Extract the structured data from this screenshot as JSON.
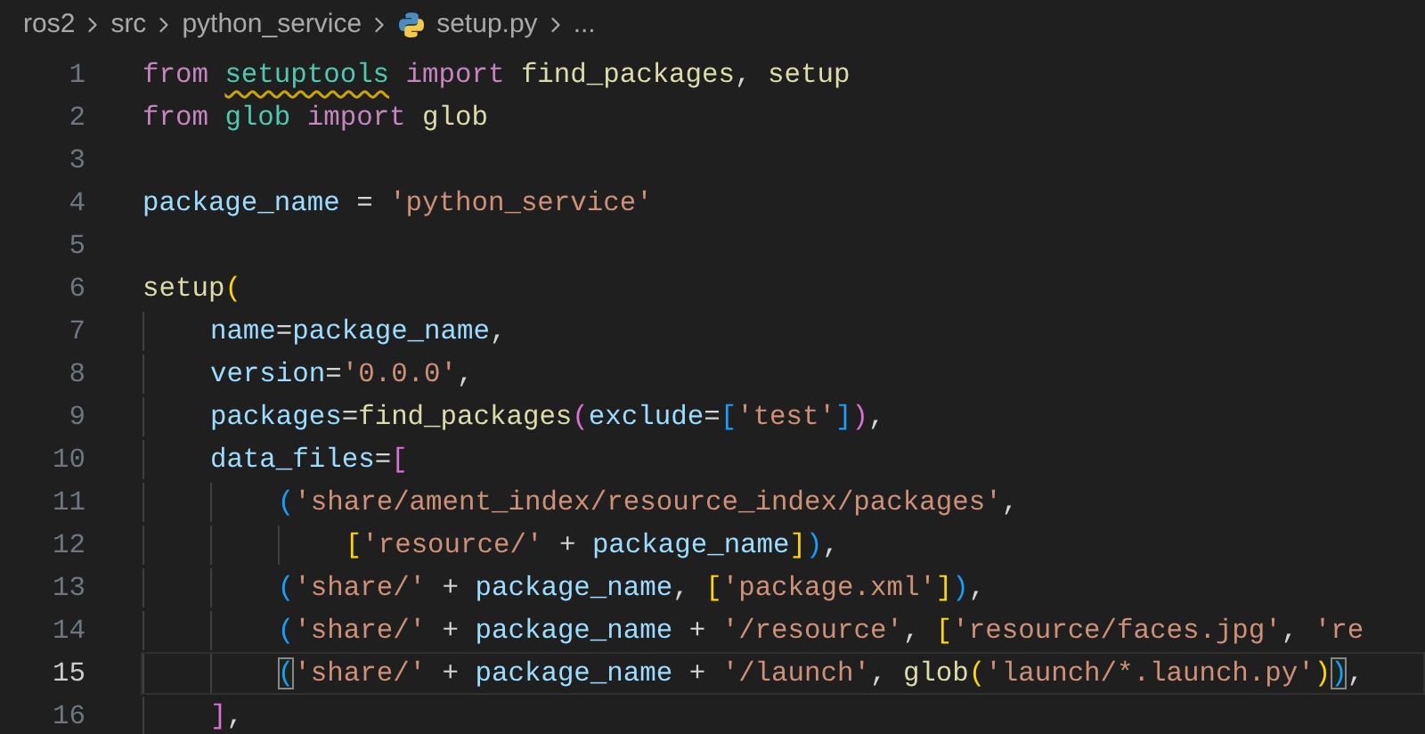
{
  "breadcrumb": [
    {
      "label": "ros2",
      "kind": "folder"
    },
    {
      "label": "src",
      "kind": "folder"
    },
    {
      "label": "python_service",
      "kind": "folder"
    },
    {
      "label": "setup.py",
      "kind": "python-file"
    },
    {
      "label": "...",
      "kind": "more"
    }
  ],
  "editor": {
    "lines": [
      {
        "number": "1",
        "current": false,
        "tokens": [
          {
            "text": "from ",
            "kind": "keyword"
          },
          {
            "text": "setuptools",
            "kind": "module-warning"
          },
          {
            "text": " import ",
            "kind": "keyword"
          },
          {
            "text": "find_packages",
            "kind": "function"
          },
          {
            "text": ", ",
            "kind": "operator"
          },
          {
            "text": "setup",
            "kind": "function"
          }
        ]
      },
      {
        "number": "2",
        "current": false,
        "tokens": [
          {
            "text": "from ",
            "kind": "keyword"
          },
          {
            "text": "glob",
            "kind": "module"
          },
          {
            "text": " import ",
            "kind": "keyword"
          },
          {
            "text": "glob",
            "kind": "function"
          }
        ]
      },
      {
        "number": "3",
        "current": false
      },
      {
        "number": "4",
        "current": false,
        "tokens": [
          {
            "text": "package_name",
            "kind": "variable"
          },
          {
            "text": " = ",
            "kind": "operator"
          },
          {
            "text": "'python_service'",
            "kind": "string"
          }
        ]
      },
      {
        "number": "5",
        "current": false
      },
      {
        "number": "6",
        "current": false,
        "tokens": [
          {
            "text": "setup",
            "kind": "function"
          },
          {
            "text": "(",
            "kind": "bracket-gold"
          }
        ]
      },
      {
        "number": "7",
        "current": false,
        "tokens": [
          {
            "text": "    name",
            "kind": "variable"
          },
          {
            "text": "=",
            "kind": "operator"
          },
          {
            "text": "package_name",
            "kind": "variable"
          },
          {
            "text": ",",
            "kind": "operator"
          }
        ]
      },
      {
        "number": "8",
        "current": false,
        "tokens": [
          {
            "text": "    version",
            "kind": "variable"
          },
          {
            "text": "=",
            "kind": "operator"
          },
          {
            "text": "'0.0.0'",
            "kind": "string"
          },
          {
            "text": ",",
            "kind": "operator"
          }
        ]
      },
      {
        "number": "9",
        "current": false,
        "tokens": [
          {
            "text": "    packages",
            "kind": "variable"
          },
          {
            "text": "=",
            "kind": "operator"
          },
          {
            "text": "find_packages",
            "kind": "function"
          },
          {
            "text": "(",
            "kind": "bracket-pink"
          },
          {
            "text": "exclude",
            "kind": "variable"
          },
          {
            "text": "=",
            "kind": "operator"
          },
          {
            "text": "[",
            "kind": "bracket-blue"
          },
          {
            "text": "'test'",
            "kind": "string"
          },
          {
            "text": "]",
            "kind": "bracket-blue"
          },
          {
            "text": ")",
            "kind": "bracket-pink"
          },
          {
            "text": ",",
            "kind": "operator"
          }
        ]
      },
      {
        "number": "10",
        "current": false,
        "tokens": [
          {
            "text": "    data_files",
            "kind": "variable"
          },
          {
            "text": "=",
            "kind": "operator"
          },
          {
            "text": "[",
            "kind": "bracket-pink"
          }
        ]
      },
      {
        "number": "11",
        "current": false,
        "tokens": [
          {
            "text": "        (",
            "kind": "bracket-blue"
          },
          {
            "text": "'share/ament_index/resource_index/packages'",
            "kind": "string"
          },
          {
            "text": ",",
            "kind": "operator"
          }
        ]
      },
      {
        "number": "12",
        "current": false,
        "tokens": [
          {
            "text": "            [",
            "kind": "bracket-gold"
          },
          {
            "text": "'resource/'",
            "kind": "string"
          },
          {
            "text": " + ",
            "kind": "operator"
          },
          {
            "text": "package_name",
            "kind": "variable"
          },
          {
            "text": "]",
            "kind": "bracket-gold"
          },
          {
            "text": ")",
            "kind": "bracket-blue"
          },
          {
            "text": ",",
            "kind": "operator"
          }
        ]
      },
      {
        "number": "13",
        "current": false,
        "tokens": [
          {
            "text": "        (",
            "kind": "bracket-blue"
          },
          {
            "text": "'share/'",
            "kind": "string"
          },
          {
            "text": " + ",
            "kind": "operator"
          },
          {
            "text": "package_name",
            "kind": "variable"
          },
          {
            "text": ", ",
            "kind": "operator"
          },
          {
            "text": "[",
            "kind": "bracket-gold"
          },
          {
            "text": "'package.xml'",
            "kind": "string"
          },
          {
            "text": "]",
            "kind": "bracket-gold"
          },
          {
            "text": ")",
            "kind": "bracket-blue"
          },
          {
            "text": ",",
            "kind": "operator"
          }
        ]
      },
      {
        "number": "14",
        "current": false,
        "tokens": [
          {
            "text": "        (",
            "kind": "bracket-blue"
          },
          {
            "text": "'share/'",
            "kind": "string"
          },
          {
            "text": " + ",
            "kind": "operator"
          },
          {
            "text": "package_name",
            "kind": "variable"
          },
          {
            "text": " + ",
            "kind": "operator"
          },
          {
            "text": "'/resource'",
            "kind": "string"
          },
          {
            "text": ", ",
            "kind": "operator"
          },
          {
            "text": "[",
            "kind": "bracket-gold"
          },
          {
            "text": "'resource/faces.jpg'",
            "kind": "string"
          },
          {
            "text": ", ",
            "kind": "operator"
          },
          {
            "text": "'re",
            "kind": "string"
          }
        ]
      },
      {
        "number": "15",
        "current": true,
        "tokens": [
          {
            "text": "        (",
            "kind": "bracket-blue-matched"
          },
          {
            "text": "'share/'",
            "kind": "string"
          },
          {
            "text": " + ",
            "kind": "operator"
          },
          {
            "text": "package_name",
            "kind": "variable"
          },
          {
            "text": " + ",
            "kind": "operator"
          },
          {
            "text": "'/launch'",
            "kind": "string"
          },
          {
            "text": ", ",
            "kind": "operator"
          },
          {
            "text": "glob",
            "kind": "function"
          },
          {
            "text": "(",
            "kind": "bracket-gold"
          },
          {
            "text": "'launch/*.launch.py'",
            "kind": "string"
          },
          {
            "text": ")",
            "kind": "bracket-gold"
          },
          {
            "text": ")",
            "kind": "bracket-blue-matched"
          },
          {
            "text": ",",
            "kind": "operator"
          }
        ]
      },
      {
        "number": "16",
        "current": false,
        "tokens": [
          {
            "text": "    ]",
            "kind": "bracket-pink"
          },
          {
            "text": ",",
            "kind": "operator"
          }
        ]
      }
    ]
  }
}
